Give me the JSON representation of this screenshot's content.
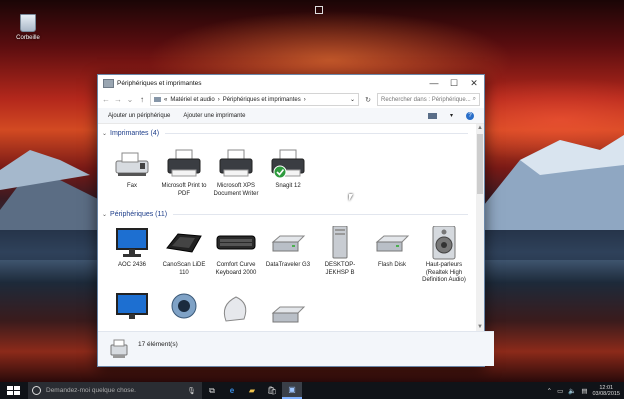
{
  "desktop": {
    "recycle_bin_label": "Corbeille"
  },
  "window": {
    "title": "Périphériques et imprimantes",
    "controls": {
      "minimize": "—",
      "maximize": "☐",
      "close": "✕"
    },
    "address": {
      "prefix": "«",
      "crumb1": "Matériel et audio",
      "sep": "›",
      "crumb2": "Périphériques et imprimantes",
      "dropdown": "⌄",
      "refresh": "↻"
    },
    "search_placeholder": "Rechercher dans : Périphérique...",
    "commands": {
      "add_device": "Ajouter un périphérique",
      "add_printer": "Ajouter une imprimante"
    },
    "groups": {
      "printers": {
        "title": "Imprimantes (4)",
        "items": [
          {
            "name": "Fax",
            "icon": "fax-icon"
          },
          {
            "name": "Microsoft Print to PDF",
            "icon": "printer-icon"
          },
          {
            "name": "Microsoft XPS Document Writer",
            "icon": "printer-icon"
          },
          {
            "name": "Snagit 12",
            "icon": "printer-default-icon"
          }
        ]
      },
      "devices": {
        "title": "Périphériques (11)",
        "items": [
          {
            "name": "AOC 2436",
            "icon": "monitor-icon"
          },
          {
            "name": "CanoScan LiDE 110",
            "icon": "scanner-icon"
          },
          {
            "name": "Comfort Curve Keyboard 2000",
            "icon": "keyboard-icon"
          },
          {
            "name": "DataTraveler G3",
            "icon": "drive-icon"
          },
          {
            "name": "DESKTOP-JEKHSP B",
            "icon": "computer-icon"
          },
          {
            "name": "Flash Disk",
            "icon": "drive-icon"
          },
          {
            "name": "Haut-parleurs (Realtek High Definition Audio)",
            "icon": "speaker-icon"
          }
        ]
      }
    },
    "status": {
      "count": "17 élément(s)"
    }
  },
  "taskbar": {
    "search_placeholder": "Demandez-moi quelque chose.",
    "clock_time": "12:01",
    "clock_date": "03/08/2015"
  },
  "colors": {
    "accent": "#2a6fc9",
    "group_header": "#1e3e8a"
  }
}
